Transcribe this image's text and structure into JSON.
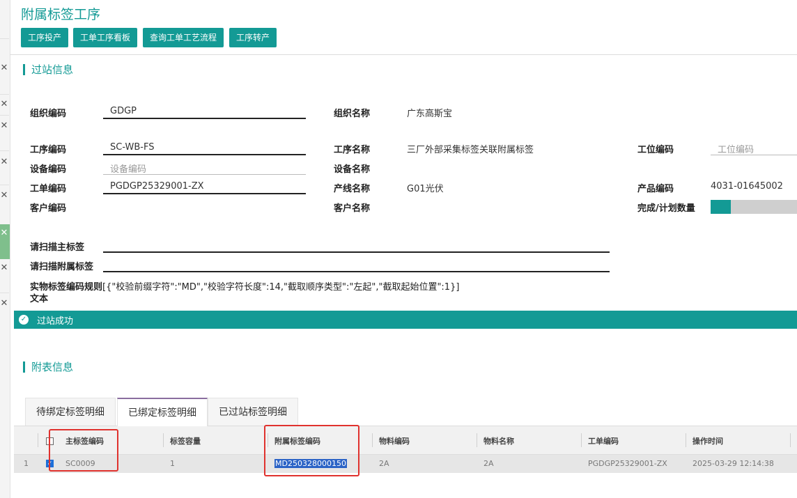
{
  "title": "附属标签工序",
  "toolbar": {
    "btn_process_input": "工序投产",
    "btn_work_order_board": "工单工序看板",
    "btn_query_routing": "查询工单工艺流程",
    "btn_process_transfer": "工序转产"
  },
  "station": {
    "section_title": "过站信息",
    "org_code_label": "组织编码",
    "org_code_value": "GDGP",
    "org_name_label": "组织名称",
    "org_name_value": "广东高斯宝",
    "process_code_label": "工序编码",
    "process_code_value": "SC-WB-FS",
    "process_name_label": "工序名称",
    "process_name_value": "三厂外部采集标签关联附属标签",
    "workstation_code_label": "工位编码",
    "workstation_code_placeholder": "工位编码",
    "equipment_code_label": "设备编码",
    "equipment_code_placeholder": "设备编码",
    "equipment_name_label": "设备名称",
    "work_order_label": "工单编码",
    "work_order_value": "PGDGP25329001-ZX",
    "line_name_label": "产线名称",
    "line_name_value": "G01光伏",
    "product_code_label": "产品编码",
    "product_code_value": "4031-01645002",
    "customer_code_label": "客户编码",
    "customer_name_label": "客户名称",
    "completion_label": "完成/计划数量",
    "completion_fraction": 0.23,
    "scan_main_label": "请扫描主标签",
    "scan_attach_label": "请扫描附属标签",
    "rule_label_line1": "实物标签编码规则",
    "rule_label_line2": "文本",
    "rule_value": "[{\"校验前缀字符\":\"MD\",\"校验字符长度\":14,\"截取顺序类型\":\"左起\",\"截取起始位置\":1}]"
  },
  "success": {
    "icon": "check-icon",
    "text": "过站成功"
  },
  "sub": {
    "section_title": "附表信息",
    "tabs": [
      "待绑定标签明细",
      "已绑定标签明细",
      "已过站标签明细"
    ],
    "active_tab": 1
  },
  "grid": {
    "columns": [
      "主标签编码",
      "标签容量",
      "附属标签编码",
      "物料编码",
      "物料名称",
      "工单编码",
      "操作时间"
    ],
    "rows": [
      {
        "index": "1",
        "checked": true,
        "main_label": "SC0009",
        "capacity": "1",
        "attach_label": "MD250328000150",
        "material_code": "2A",
        "material_name": "2A",
        "work_order": "PGDGP25329001-ZX",
        "op_time": "2025-03-29 12:14:38"
      }
    ]
  },
  "colors": {
    "accent": "#139a95",
    "highlight_box": "#e0322e",
    "active_tab_border": "#8a6d9f"
  }
}
